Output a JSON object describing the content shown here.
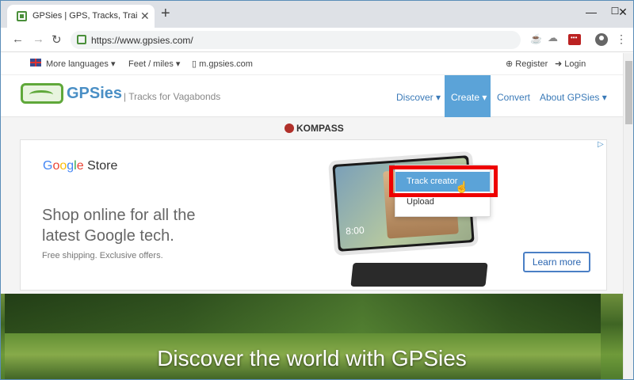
{
  "browser": {
    "tab_title": "GPSies | GPS, Tracks, Trails, Tours...",
    "tab_close": "✕",
    "new_tab": "+",
    "url": "https://www.gpsies.com/",
    "window_buttons": [
      "—",
      "☐",
      "✕"
    ],
    "icons": [
      "back-arrow-icon",
      "forward-arrow-icon",
      "reload-icon",
      "java-icon",
      "cloud-icon",
      "extension-icon",
      "profile-icon",
      "menu-icon"
    ]
  },
  "topbar": {
    "languages": "More languages ▾",
    "units": "Feet / miles ▾",
    "mobile": "▯ m.gpsies.com",
    "register": "⊕ Register",
    "login": "➜ Login"
  },
  "navbar": {
    "brand": "GPSies",
    "tagline": "| Tracks for Vagabonds",
    "discover": "Discover ▾",
    "create": "Create ▾",
    "convert": "Convert",
    "about": "About GPSies ▾"
  },
  "dropdown": {
    "items": [
      "Track creator",
      "Upload"
    ]
  },
  "sponsor": "KOMPASS",
  "ad": {
    "store_google": [
      "G",
      "o",
      "o",
      "g",
      "l",
      "e"
    ],
    "store_word": "Store",
    "headline": "Shop online for all the latest Google tech.",
    "subline": "Free shipping. Exclusive offers.",
    "button": "Learn more",
    "screen_time": "8:00"
  },
  "hero": {
    "title": "Discover the world with GPSies"
  },
  "colors": {
    "accent": "#5ba3d8",
    "highlight_box": "#e00000",
    "brand_green": "#5fa83a"
  }
}
